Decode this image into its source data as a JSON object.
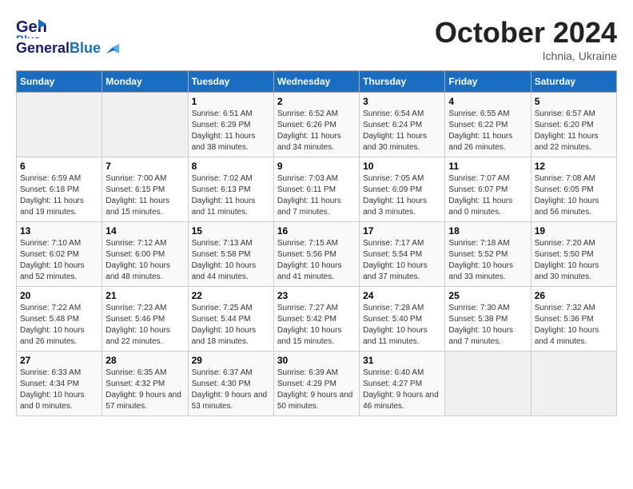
{
  "logo": {
    "general": "General",
    "blue": "Blue"
  },
  "header": {
    "month": "October 2024",
    "location": "Ichnia, Ukraine"
  },
  "weekdays": [
    "Sunday",
    "Monday",
    "Tuesday",
    "Wednesday",
    "Thursday",
    "Friday",
    "Saturday"
  ],
  "weeks": [
    [
      {
        "day": null
      },
      {
        "day": null
      },
      {
        "day": 1,
        "sunrise": "6:51 AM",
        "sunset": "6:29 PM",
        "daylight": "11 hours and 38 minutes."
      },
      {
        "day": 2,
        "sunrise": "6:52 AM",
        "sunset": "6:26 PM",
        "daylight": "11 hours and 34 minutes."
      },
      {
        "day": 3,
        "sunrise": "6:54 AM",
        "sunset": "6:24 PM",
        "daylight": "11 hours and 30 minutes."
      },
      {
        "day": 4,
        "sunrise": "6:55 AM",
        "sunset": "6:22 PM",
        "daylight": "11 hours and 26 minutes."
      },
      {
        "day": 5,
        "sunrise": "6:57 AM",
        "sunset": "6:20 PM",
        "daylight": "11 hours and 22 minutes."
      }
    ],
    [
      {
        "day": 6,
        "sunrise": "6:59 AM",
        "sunset": "6:18 PM",
        "daylight": "11 hours and 19 minutes."
      },
      {
        "day": 7,
        "sunrise": "7:00 AM",
        "sunset": "6:15 PM",
        "daylight": "11 hours and 15 minutes."
      },
      {
        "day": 8,
        "sunrise": "7:02 AM",
        "sunset": "6:13 PM",
        "daylight": "11 hours and 11 minutes."
      },
      {
        "day": 9,
        "sunrise": "7:03 AM",
        "sunset": "6:11 PM",
        "daylight": "11 hours and 7 minutes."
      },
      {
        "day": 10,
        "sunrise": "7:05 AM",
        "sunset": "6:09 PM",
        "daylight": "11 hours and 3 minutes."
      },
      {
        "day": 11,
        "sunrise": "7:07 AM",
        "sunset": "6:07 PM",
        "daylight": "11 hours and 0 minutes."
      },
      {
        "day": 12,
        "sunrise": "7:08 AM",
        "sunset": "6:05 PM",
        "daylight": "10 hours and 56 minutes."
      }
    ],
    [
      {
        "day": 13,
        "sunrise": "7:10 AM",
        "sunset": "6:02 PM",
        "daylight": "10 hours and 52 minutes."
      },
      {
        "day": 14,
        "sunrise": "7:12 AM",
        "sunset": "6:00 PM",
        "daylight": "10 hours and 48 minutes."
      },
      {
        "day": 15,
        "sunrise": "7:13 AM",
        "sunset": "5:58 PM",
        "daylight": "10 hours and 44 minutes."
      },
      {
        "day": 16,
        "sunrise": "7:15 AM",
        "sunset": "5:56 PM",
        "daylight": "10 hours and 41 minutes."
      },
      {
        "day": 17,
        "sunrise": "7:17 AM",
        "sunset": "5:54 PM",
        "daylight": "10 hours and 37 minutes."
      },
      {
        "day": 18,
        "sunrise": "7:18 AM",
        "sunset": "5:52 PM",
        "daylight": "10 hours and 33 minutes."
      },
      {
        "day": 19,
        "sunrise": "7:20 AM",
        "sunset": "5:50 PM",
        "daylight": "10 hours and 30 minutes."
      }
    ],
    [
      {
        "day": 20,
        "sunrise": "7:22 AM",
        "sunset": "5:48 PM",
        "daylight": "10 hours and 26 minutes."
      },
      {
        "day": 21,
        "sunrise": "7:23 AM",
        "sunset": "5:46 PM",
        "daylight": "10 hours and 22 minutes."
      },
      {
        "day": 22,
        "sunrise": "7:25 AM",
        "sunset": "5:44 PM",
        "daylight": "10 hours and 18 minutes."
      },
      {
        "day": 23,
        "sunrise": "7:27 AM",
        "sunset": "5:42 PM",
        "daylight": "10 hours and 15 minutes."
      },
      {
        "day": 24,
        "sunrise": "7:28 AM",
        "sunset": "5:40 PM",
        "daylight": "10 hours and 11 minutes."
      },
      {
        "day": 25,
        "sunrise": "7:30 AM",
        "sunset": "5:38 PM",
        "daylight": "10 hours and 7 minutes."
      },
      {
        "day": 26,
        "sunrise": "7:32 AM",
        "sunset": "5:36 PM",
        "daylight": "10 hours and 4 minutes."
      }
    ],
    [
      {
        "day": 27,
        "sunrise": "6:33 AM",
        "sunset": "4:34 PM",
        "daylight": "10 hours and 0 minutes."
      },
      {
        "day": 28,
        "sunrise": "6:35 AM",
        "sunset": "4:32 PM",
        "daylight": "9 hours and 57 minutes."
      },
      {
        "day": 29,
        "sunrise": "6:37 AM",
        "sunset": "4:30 PM",
        "daylight": "9 hours and 53 minutes."
      },
      {
        "day": 30,
        "sunrise": "6:39 AM",
        "sunset": "4:29 PM",
        "daylight": "9 hours and 50 minutes."
      },
      {
        "day": 31,
        "sunrise": "6:40 AM",
        "sunset": "4:27 PM",
        "daylight": "9 hours and 46 minutes."
      },
      {
        "day": null
      },
      {
        "day": null
      }
    ]
  ]
}
